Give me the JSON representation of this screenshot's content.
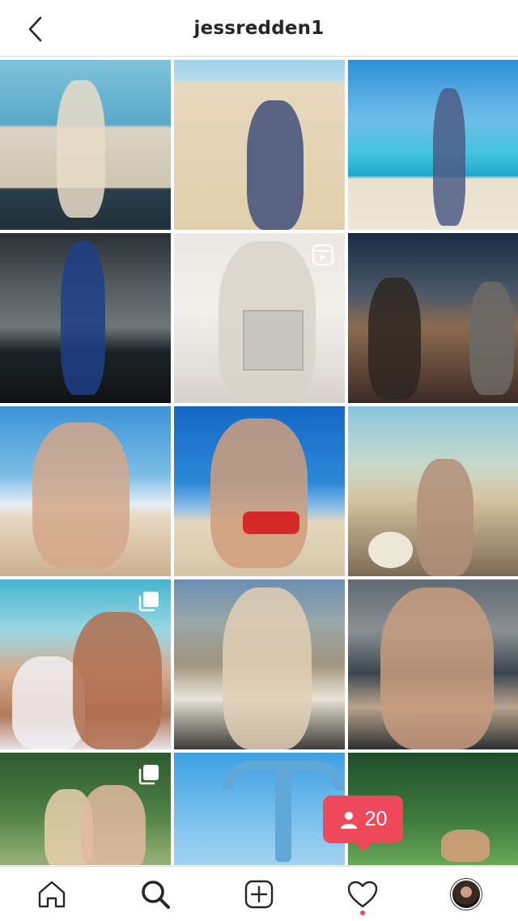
{
  "header": {
    "title": "jessredden1",
    "back_icon": "chevron-left-icon"
  },
  "grid": {
    "tiles": [
      {
        "badge": null
      },
      {
        "badge": null
      },
      {
        "badge": null
      },
      {
        "badge": null
      },
      {
        "badge": "reels-icon"
      },
      {
        "badge": null
      },
      {
        "badge": null
      },
      {
        "badge": null
      },
      {
        "badge": null
      },
      {
        "badge": "carousel-icon"
      },
      {
        "badge": null
      },
      {
        "badge": null
      },
      {
        "badge": "carousel-icon"
      },
      {
        "badge": null
      },
      {
        "badge": null
      }
    ]
  },
  "follow_notification": {
    "icon": "user-icon",
    "count": "20",
    "color": "#ee4a5c"
  },
  "tabbar": {
    "items": [
      "home-icon",
      "search-icon",
      "new-post-icon",
      "activity-heart-icon",
      "profile-avatar"
    ],
    "active": "search-icon",
    "activity_dot_color": "#ed4956"
  }
}
